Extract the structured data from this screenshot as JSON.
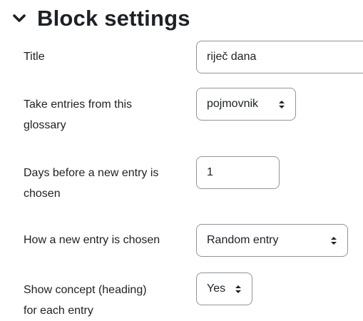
{
  "section": {
    "title": "Block settings",
    "toggle_icon": "chevron-down-icon"
  },
  "fields": {
    "title": {
      "label": "Title",
      "value": "riječ dana"
    },
    "glossary": {
      "label_line1": "Take entries from this",
      "label_line2": "glossary",
      "selected": "pojmovnik"
    },
    "days": {
      "label_line1": "Days before a new entry is",
      "label_line2": "chosen",
      "value": "1"
    },
    "method": {
      "label": "How a new entry is chosen",
      "selected": "Random entry"
    },
    "concept": {
      "label_line1": "Show concept (heading)",
      "label_line2": "for each entry",
      "selected": "Yes"
    }
  }
}
